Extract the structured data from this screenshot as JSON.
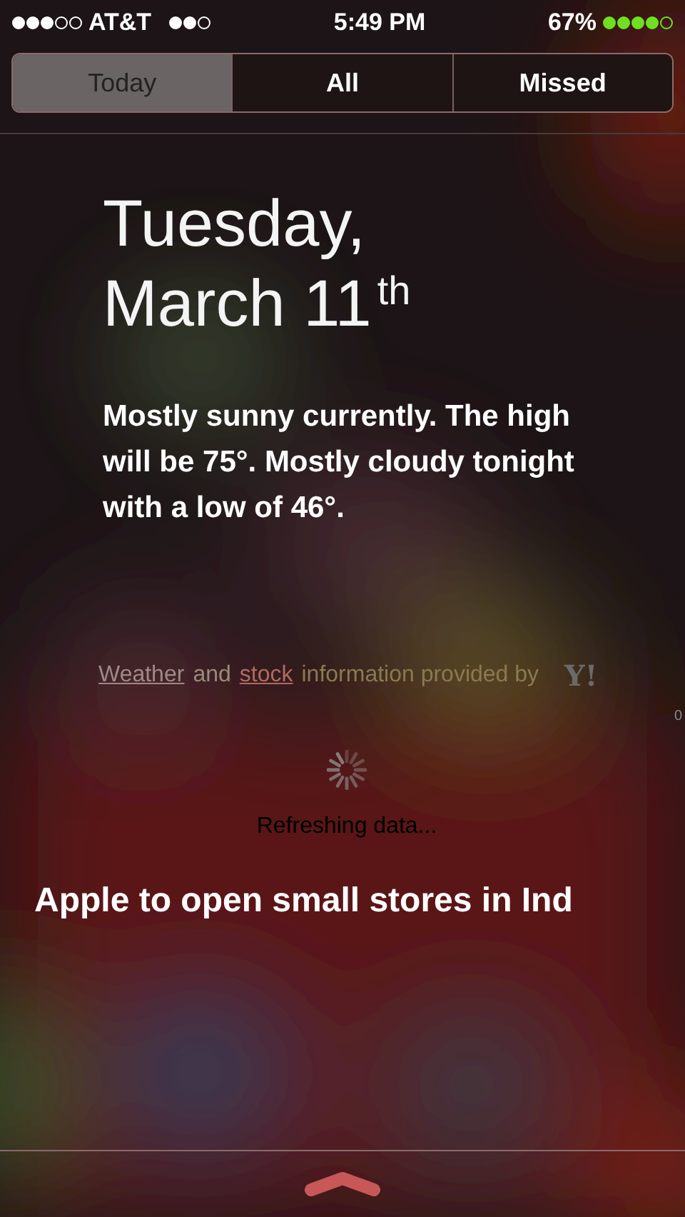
{
  "status_bar": {
    "carrier": "AT&T",
    "time": "5:49 PM",
    "battery": "67%"
  },
  "tabs": [
    {
      "label": "Today",
      "selected": true
    },
    {
      "label": "All",
      "selected": false
    },
    {
      "label": "Missed",
      "selected": false
    }
  ],
  "date": {
    "line_1": "Tuesday,",
    "line_2": "March 11$^{th}$"
  },
  "weather_summary": "Mostly sunny currently. The high will be 75°. Mostly cloudy tonight with a low of 46°.",
  "attribution": {
    "link_1": "Weather",
    "middle": "and",
    "link_2": "stock",
    "end": "information provided by",
    "logo": "Y!"
  },
  "edge_mark": "0",
  "loading": {
    "text": "Refreshing data..."
  },
  "headline": "Apple to open small stores in Ind"
}
